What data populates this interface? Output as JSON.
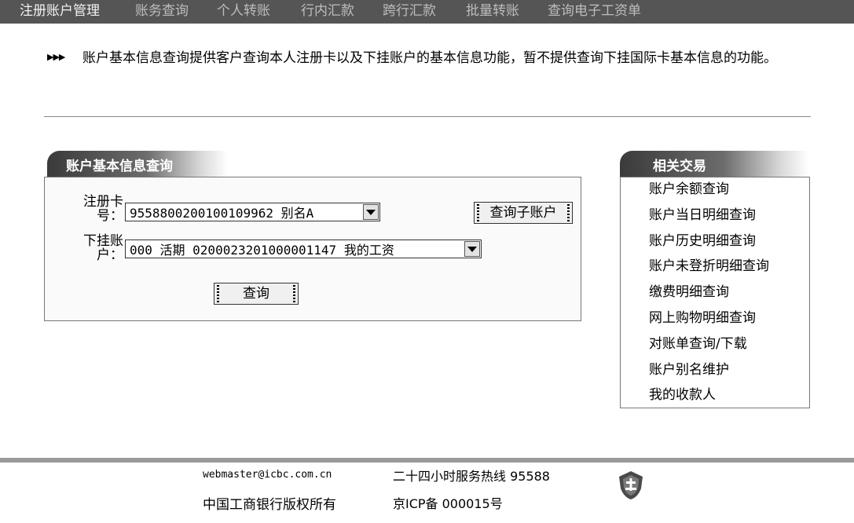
{
  "nav": {
    "items": [
      "注册账户管理",
      "账务查询",
      "个人转账",
      "行内汇款",
      "跨行汇款",
      "批量转账",
      "查询电子工资单"
    ]
  },
  "notice": {
    "arrows": "▶▶▶",
    "text": "账户基本信息查询提供客户查询本人注册卡以及下挂账户的基本信息功能，暂不提供查询下挂国际卡基本信息的功能。"
  },
  "query_panel": {
    "title": "账户基本信息查询",
    "card_label_line1": "注册卡",
    "card_label_line2": "号：",
    "card_value": "9558800200100109962 别名A",
    "sub_label_line1": "下挂账",
    "sub_label_line2": "户：",
    "sub_value": "000 活期 0200023201000001147 我的工资",
    "subaccount_button": "查询子账户",
    "query_button": "查询"
  },
  "related": {
    "title": "相关交易",
    "items": [
      "账户余额查询",
      "账户当日明细查询",
      "账户历史明细查询",
      "账户未登折明细查询",
      "缴费明细查询",
      "网上购物明细查询",
      "对账单查询/下载",
      "账户别名维护",
      "我的收款人"
    ]
  },
  "footer": {
    "email": "webmaster@icbc.com.cn",
    "hotline": "二十四小时服务热线 95588",
    "copyright": "中国工商银行版权所有",
    "icp": "京ICP备 000015号"
  },
  "colors": {
    "nav_bg": "#555555",
    "tab_dark": "#3a3a3a"
  }
}
